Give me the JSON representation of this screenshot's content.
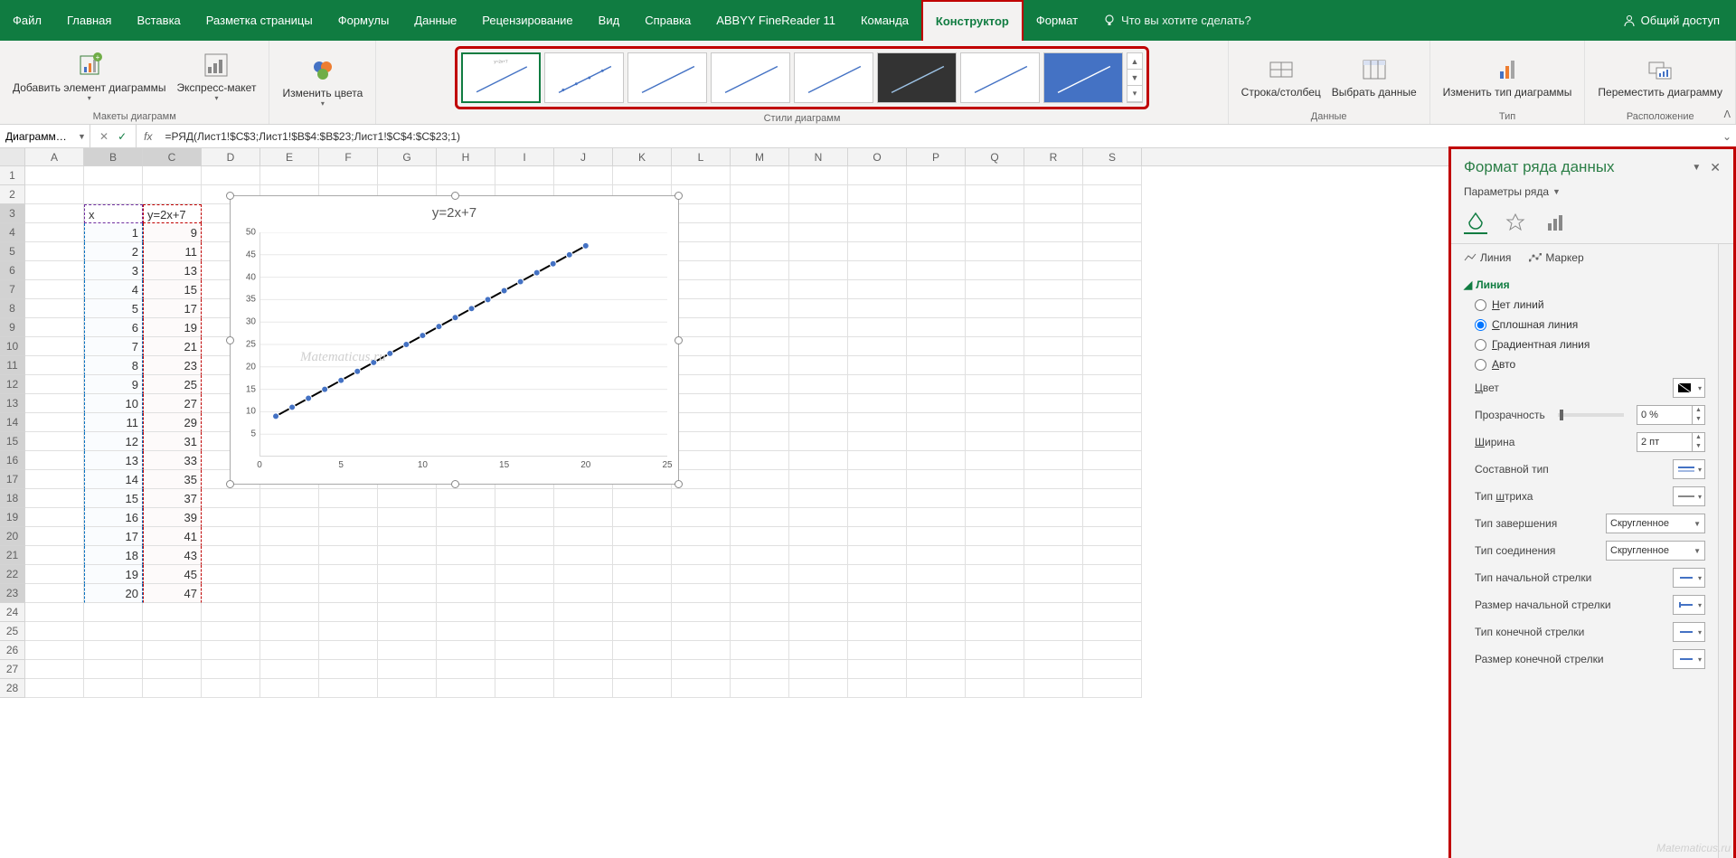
{
  "tabs": {
    "file": "Файл",
    "home": "Главная",
    "insert": "Вставка",
    "layout": "Разметка страницы",
    "formulas": "Формулы",
    "data": "Данные",
    "review": "Рецензирование",
    "view": "Вид",
    "help": "Справка",
    "abbyy": "ABBYY FineReader 11",
    "team": "Команда",
    "design": "Конструктор",
    "format": "Формат"
  },
  "tellme": "Что вы хотите сделать?",
  "share": "Общий доступ",
  "ribbon": {
    "add_element": "Добавить элемент диаграммы",
    "quick_layout": "Экспресс-макет",
    "change_colors": "Изменить цвета",
    "styles_label": "Стили диаграмм",
    "layouts_label": "Макеты диаграмм",
    "switch": "Строка/столбец",
    "select_data": "Выбрать данные",
    "data_label": "Данные",
    "change_type": "Изменить тип диаграммы",
    "type_label": "Тип",
    "move_chart": "Переместить диаграмму",
    "location_label": "Расположение"
  },
  "name_box": "Диаграмм…",
  "formula": "=РЯД(Лист1!$C$3;Лист1!$B$4:$B$23;Лист1!$C$4:$C$23;1)",
  "columns": [
    "A",
    "B",
    "C",
    "D",
    "E",
    "F",
    "G",
    "H",
    "I",
    "J",
    "K",
    "L",
    "M",
    "N",
    "O",
    "P",
    "Q",
    "R",
    "S"
  ],
  "sheet": {
    "b3": "x",
    "c3": "y=2x+7",
    "rows": [
      {
        "b": "1",
        "c": "9"
      },
      {
        "b": "2",
        "c": "11"
      },
      {
        "b": "3",
        "c": "13"
      },
      {
        "b": "4",
        "c": "15"
      },
      {
        "b": "5",
        "c": "17"
      },
      {
        "b": "6",
        "c": "19"
      },
      {
        "b": "7",
        "c": "21"
      },
      {
        "b": "8",
        "c": "23"
      },
      {
        "b": "9",
        "c": "25"
      },
      {
        "b": "10",
        "c": "27"
      },
      {
        "b": "11",
        "c": "29"
      },
      {
        "b": "12",
        "c": "31"
      },
      {
        "b": "13",
        "c": "33"
      },
      {
        "b": "14",
        "c": "35"
      },
      {
        "b": "15",
        "c": "37"
      },
      {
        "b": "16",
        "c": "39"
      },
      {
        "b": "17",
        "c": "41"
      },
      {
        "b": "18",
        "c": "43"
      },
      {
        "b": "19",
        "c": "45"
      },
      {
        "b": "20",
        "c": "47"
      }
    ]
  },
  "chart_data": {
    "type": "line",
    "title": "y=2x+7",
    "x": [
      1,
      2,
      3,
      4,
      5,
      6,
      7,
      8,
      9,
      10,
      11,
      12,
      13,
      14,
      15,
      16,
      17,
      18,
      19,
      20
    ],
    "values": [
      9,
      11,
      13,
      15,
      17,
      19,
      21,
      23,
      25,
      27,
      29,
      31,
      33,
      35,
      37,
      39,
      41,
      43,
      45,
      47
    ],
    "xlim": [
      0,
      25
    ],
    "ylim": [
      0,
      50
    ],
    "y_ticks": [
      5,
      10,
      15,
      20,
      25,
      30,
      35,
      40,
      45,
      50
    ],
    "x_ticks": [
      0,
      5,
      10,
      15,
      20,
      25
    ],
    "xlabel": "",
    "ylabel": ""
  },
  "watermark": "Matematicus.ru",
  "format_pane": {
    "title": "Формат ряда данных",
    "subtitle": "Параметры ряда",
    "tab_line": "Линия",
    "tab_marker": "Маркер",
    "section_line": "Линия",
    "r_none": "Нет линий",
    "r_solid": "Сплошная линия",
    "r_grad": "Градиентная линия",
    "r_auto": "Авто",
    "color": "Цвет",
    "transparency": "Прозрачность",
    "t_val": "0 %",
    "width": "Ширина",
    "w_val": "2 пт",
    "compound": "Составной тип",
    "dash": "Тип штриха",
    "cap": "Тип завершения",
    "cap_val": "Скругленное",
    "join": "Тип соединения",
    "join_val": "Скругленное",
    "begin_arrow": "Тип начальной стрелки",
    "begin_size": "Размер начальной стрелки",
    "end_arrow": "Тип конечной стрелки",
    "end_size": "Размер конечной стрелки"
  }
}
